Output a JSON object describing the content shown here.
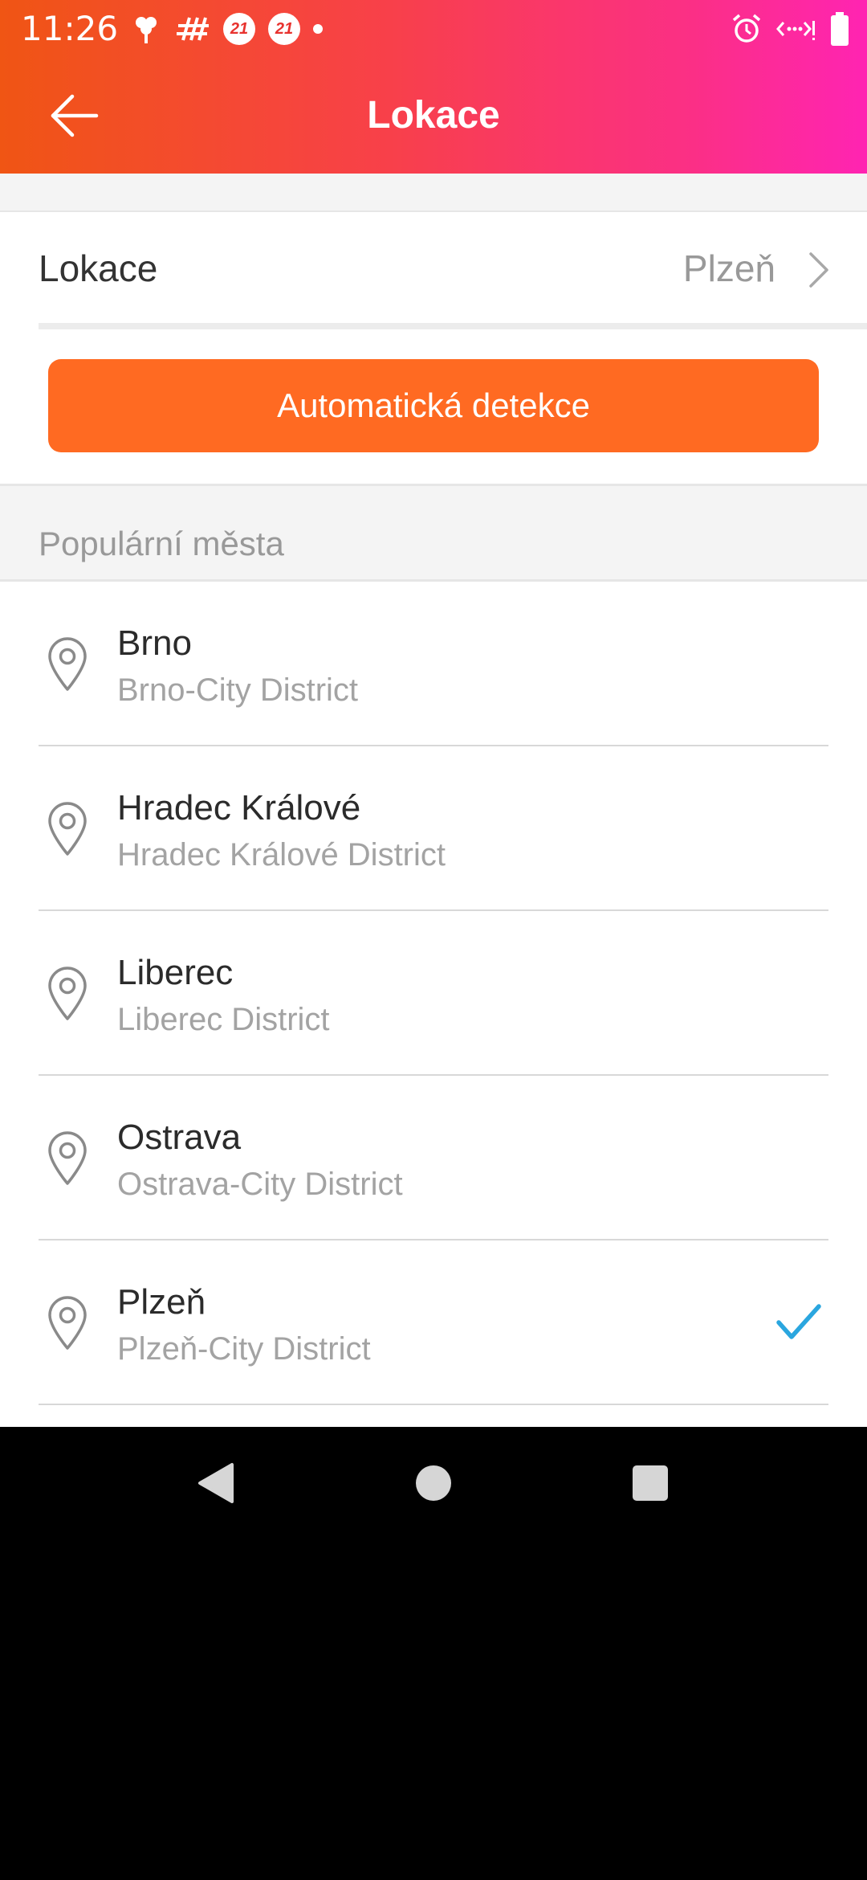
{
  "status_bar": {
    "time": "11:26",
    "badge_1": "21",
    "badge_2": "21"
  },
  "app_bar": {
    "title": "Lokace"
  },
  "location": {
    "label": "Lokace",
    "value": "Plzeň"
  },
  "auto_detect": {
    "label": "Automatická detekce"
  },
  "popular": {
    "title": "Populární města",
    "cities": [
      {
        "name": "Brno",
        "district": "Brno-City District",
        "selected": false
      },
      {
        "name": "Hradec Králové",
        "district": "Hradec Králové District",
        "selected": false
      },
      {
        "name": "Liberec",
        "district": "Liberec District",
        "selected": false
      },
      {
        "name": "Ostrava",
        "district": "Ostrava-City District",
        "selected": false
      },
      {
        "name": "Plzeň",
        "district": "Plzeň-City District",
        "selected": true
      }
    ]
  },
  "colors": {
    "accent_orange": "#ff6a22",
    "check_blue": "#2aa6df",
    "header_gradient_start": "#f05514",
    "header_gradient_end": "#ff24b2"
  },
  "icons": {
    "back": "arrow-left-icon",
    "chevron": "chevron-right-icon",
    "city": "map-pin-icon",
    "selected": "checkmark-icon"
  }
}
